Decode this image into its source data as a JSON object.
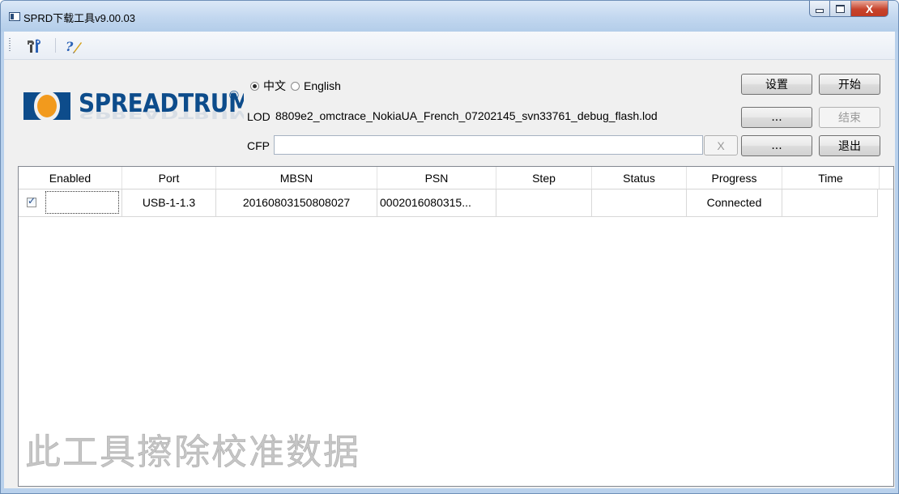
{
  "window": {
    "title": "SPRD下载工具v9.00.03",
    "controls": {
      "minimize": "minimize-icon",
      "maximize": "maximize-icon",
      "close": "X"
    }
  },
  "toolbar": {
    "items": [
      {
        "icon": "tools-icon"
      },
      {
        "icon": "help-icon"
      }
    ]
  },
  "logo": {
    "text": "SPREADTRUM",
    "registered": "®"
  },
  "language": {
    "options": [
      {
        "label": "中文",
        "selected": true
      },
      {
        "label": "English",
        "selected": false
      }
    ]
  },
  "lod": {
    "label": "LOD",
    "value": "8809e2_omctrace_NokiaUA_French_07202145_svn33761_debug_flash.lod",
    "browse": "..."
  },
  "cfp": {
    "label": "CFP",
    "value": "",
    "clear": "X",
    "browse": "..."
  },
  "buttons": {
    "settings": "设置",
    "start": "开始",
    "stop": "结束",
    "exit": "退出"
  },
  "table": {
    "columns": [
      "Enabled",
      "Port",
      "MBSN",
      "PSN",
      "Step",
      "Status",
      "Progress",
      "Time"
    ],
    "rows": [
      {
        "enabled": true,
        "port": "USB-1-1.3",
        "mbsn": "20160803150808027",
        "psn": "0002016080315...",
        "step": "",
        "status": "",
        "progress": "Connected",
        "time": ""
      }
    ]
  },
  "watermark": "此工具擦除校准数据",
  "colors": {
    "brand": "#0d4c8b",
    "title_bar": "#c2d7ef",
    "close_button": "#c7432c"
  }
}
